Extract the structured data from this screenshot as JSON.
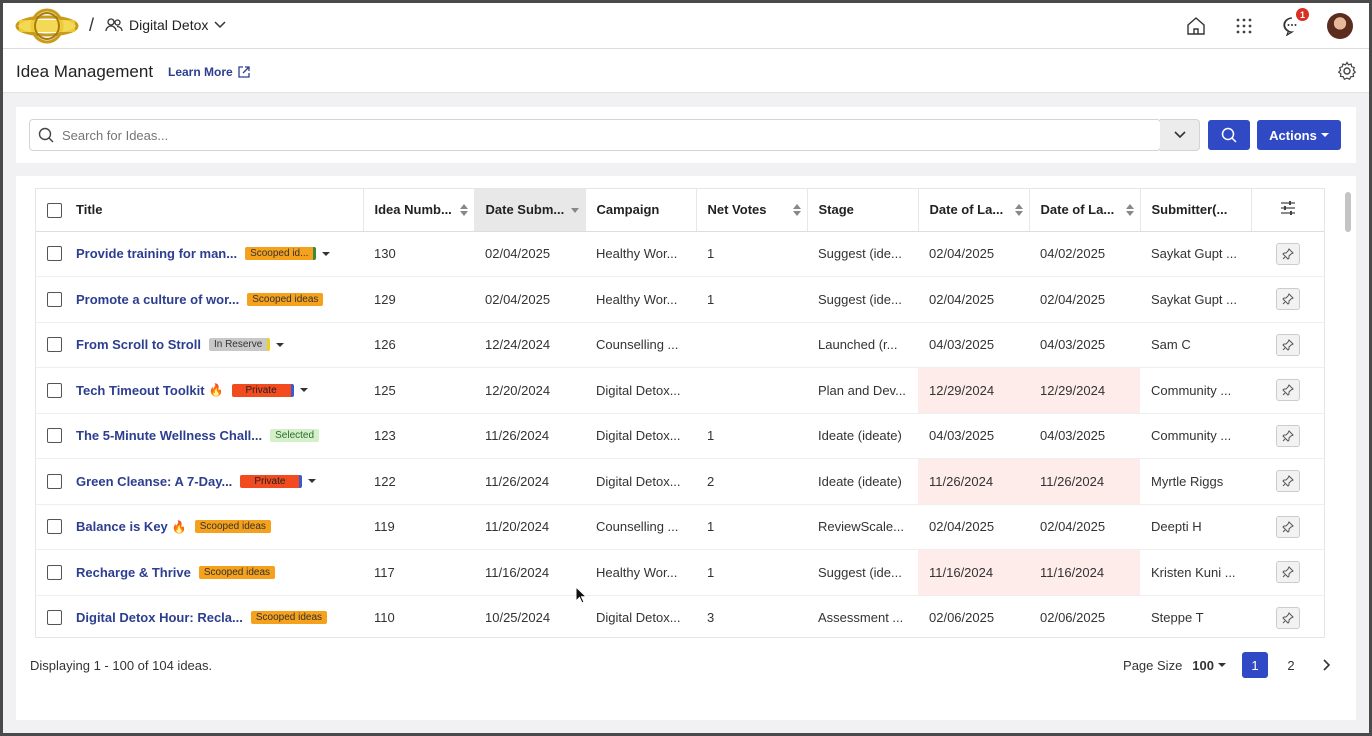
{
  "breadcrumb": {
    "separator": "/",
    "community": "Digital Detox"
  },
  "notifications": {
    "count": "1"
  },
  "page": {
    "title": "Idea Management",
    "learn_more": "Learn More"
  },
  "search": {
    "placeholder": "Search for Ideas...",
    "value": "",
    "actions_label": "Actions"
  },
  "table": {
    "columns": [
      "Title",
      "Idea Numb...",
      "Date Subm...",
      "Campaign",
      "Net Votes",
      "Stage",
      "Date of La...",
      "Date of La...",
      "Submitter(..."
    ],
    "rows": [
      {
        "title": "Provide training for man...",
        "tag": "Scooped id...",
        "tagType": "scoop-g",
        "caret": true,
        "fire": false,
        "num": "130",
        "date": "02/04/2025",
        "campaign": "Healthy Wor...",
        "votes": "1",
        "stage": "Suggest (ide...",
        "d1": "02/04/2025",
        "d2": "04/02/2025",
        "submitter": "Saykat Gupt ...",
        "warn": false
      },
      {
        "title": "Promote a culture of wor...",
        "tag": "Scooped ideas",
        "tagType": "scoop",
        "caret": false,
        "fire": false,
        "num": "129",
        "date": "02/04/2025",
        "campaign": "Healthy Wor...",
        "votes": "1",
        "stage": "Suggest (ide...",
        "d1": "02/04/2025",
        "d2": "02/04/2025",
        "submitter": "Saykat Gupt ...",
        "warn": false
      },
      {
        "title": "From Scroll to Stroll",
        "tag": "In Reserve",
        "tagType": "res",
        "caret": true,
        "fire": false,
        "num": "126",
        "date": "12/24/2024",
        "campaign": "Counselling ...",
        "votes": "",
        "stage": "Launched (r...",
        "d1": "04/03/2025",
        "d2": "04/03/2025",
        "submitter": "Sam C",
        "warn": false
      },
      {
        "title": "Tech Timeout Toolkit",
        "tag": "Private",
        "tagType": "priv",
        "caret": true,
        "fire": true,
        "num": "125",
        "date": "12/20/2024",
        "campaign": "Digital Detox...",
        "votes": "",
        "stage": "Plan and Dev...",
        "d1": "12/29/2024",
        "d2": "12/29/2024",
        "submitter": "Community  ...",
        "warn": true
      },
      {
        "title": "The 5-Minute Wellness Chall...",
        "tag": "Selected",
        "tagType": "sel",
        "caret": false,
        "fire": false,
        "num": "123",
        "date": "11/26/2024",
        "campaign": "Digital Detox...",
        "votes": "1",
        "stage": "Ideate (ideate)",
        "d1": "04/03/2025",
        "d2": "04/03/2025",
        "submitter": "Community  ...",
        "warn": false
      },
      {
        "title": "Green Cleanse: A 7-Day...",
        "tag": "Private",
        "tagType": "priv",
        "caret": true,
        "fire": false,
        "num": "122",
        "date": "11/26/2024",
        "campaign": "Digital Detox...",
        "votes": "2",
        "stage": "Ideate (ideate)",
        "d1": "11/26/2024",
        "d2": "11/26/2024",
        "submitter": "Myrtle Riggs",
        "warn": true
      },
      {
        "title": "Balance is Key",
        "tag": "Scooped ideas",
        "tagType": "scoop",
        "caret": false,
        "fire": true,
        "num": "119",
        "date": "11/20/2024",
        "campaign": "Counselling ...",
        "votes": "1",
        "stage": "ReviewScale...",
        "d1": "02/04/2025",
        "d2": "02/04/2025",
        "submitter": "Deepti H",
        "warn": false
      },
      {
        "title": "Recharge & Thrive",
        "tag": "Scooped ideas",
        "tagType": "scoop",
        "caret": false,
        "fire": false,
        "num": "117",
        "date": "11/16/2024",
        "campaign": "Healthy Wor...",
        "votes": "1",
        "stage": "Suggest (ide...",
        "d1": "11/16/2024",
        "d2": "11/16/2024",
        "submitter": "Kristen Kuni ...",
        "warn": true
      },
      {
        "title": "Digital Detox Hour: Recla...",
        "tag": "Scooped ideas",
        "tagType": "scoop",
        "caret": false,
        "fire": false,
        "num": "110",
        "date": "10/25/2024",
        "campaign": "Digital Detox...",
        "votes": "3",
        "stage": "Assessment ...",
        "d1": "02/06/2025",
        "d2": "02/06/2025",
        "submitter": "Steppe T",
        "warn": false
      }
    ]
  },
  "footer": {
    "displaying": "Displaying 1 - 100 of 104 ideas.",
    "page_size_label": "Page Size",
    "page_size": "100",
    "pages": [
      "1",
      "2"
    ]
  },
  "colors": {
    "accent": "#2f4ac4",
    "link": "#2c3e8f",
    "warn": "#fdecea"
  }
}
